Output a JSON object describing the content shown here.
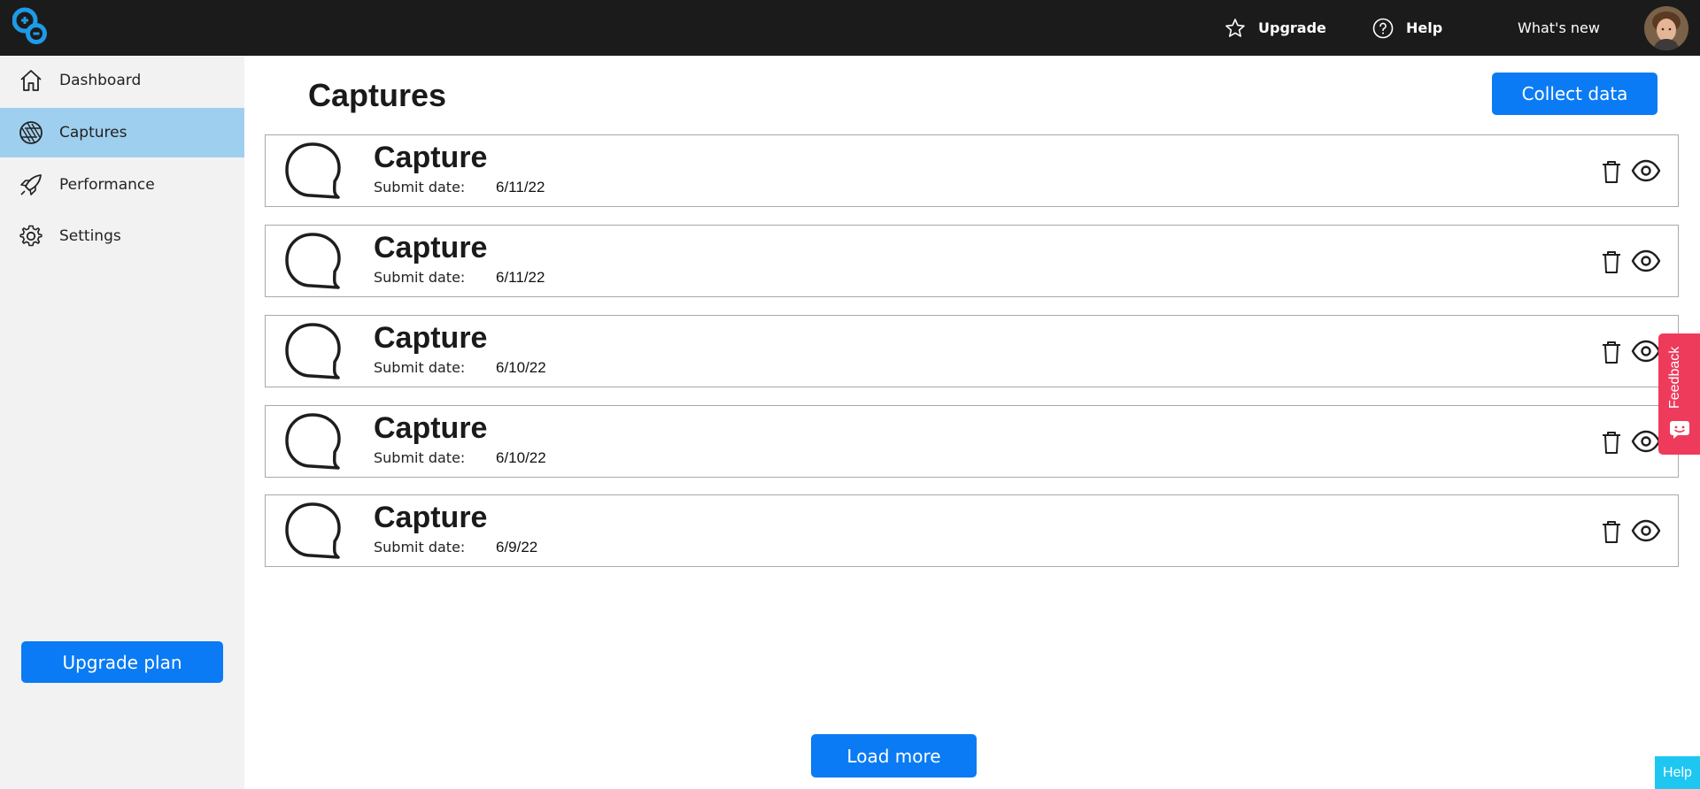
{
  "topbar": {
    "upgrade_label": "Upgrade",
    "help_label": "Help",
    "whats_new_label": "What's new"
  },
  "sidebar": {
    "items": [
      {
        "label": "Dashboard",
        "icon": "home-icon"
      },
      {
        "label": "Captures",
        "icon": "aperture-icon",
        "active": true
      },
      {
        "label": "Performance",
        "icon": "rocket-icon"
      },
      {
        "label": "Settings",
        "icon": "gear-icon"
      }
    ],
    "upgrade_plan_label": "Upgrade plan"
  },
  "main": {
    "title": "Captures",
    "collect_label": "Collect data",
    "captures": [
      {
        "title": "Capture",
        "date_label": "Submit date:",
        "date": "6/11/22"
      },
      {
        "title": "Capture",
        "date_label": "Submit date:",
        "date": "6/11/22"
      },
      {
        "title": "Capture",
        "date_label": "Submit date:",
        "date": "6/10/22"
      },
      {
        "title": "Capture",
        "date_label": "Submit date:",
        "date": "6/10/22"
      },
      {
        "title": "Capture",
        "date_label": "Submit date:",
        "date": "6/9/22"
      }
    ],
    "load_more_label": "Load more"
  },
  "widgets": {
    "feedback_label": "Feedback",
    "help_label": "Help"
  },
  "colors": {
    "topbar": "#1c1b1b",
    "primary": "#0a7bf5",
    "sidebar_active": "#9fcfee",
    "feedback": "#ee3b5c",
    "help_widget": "#1ec6f2"
  }
}
